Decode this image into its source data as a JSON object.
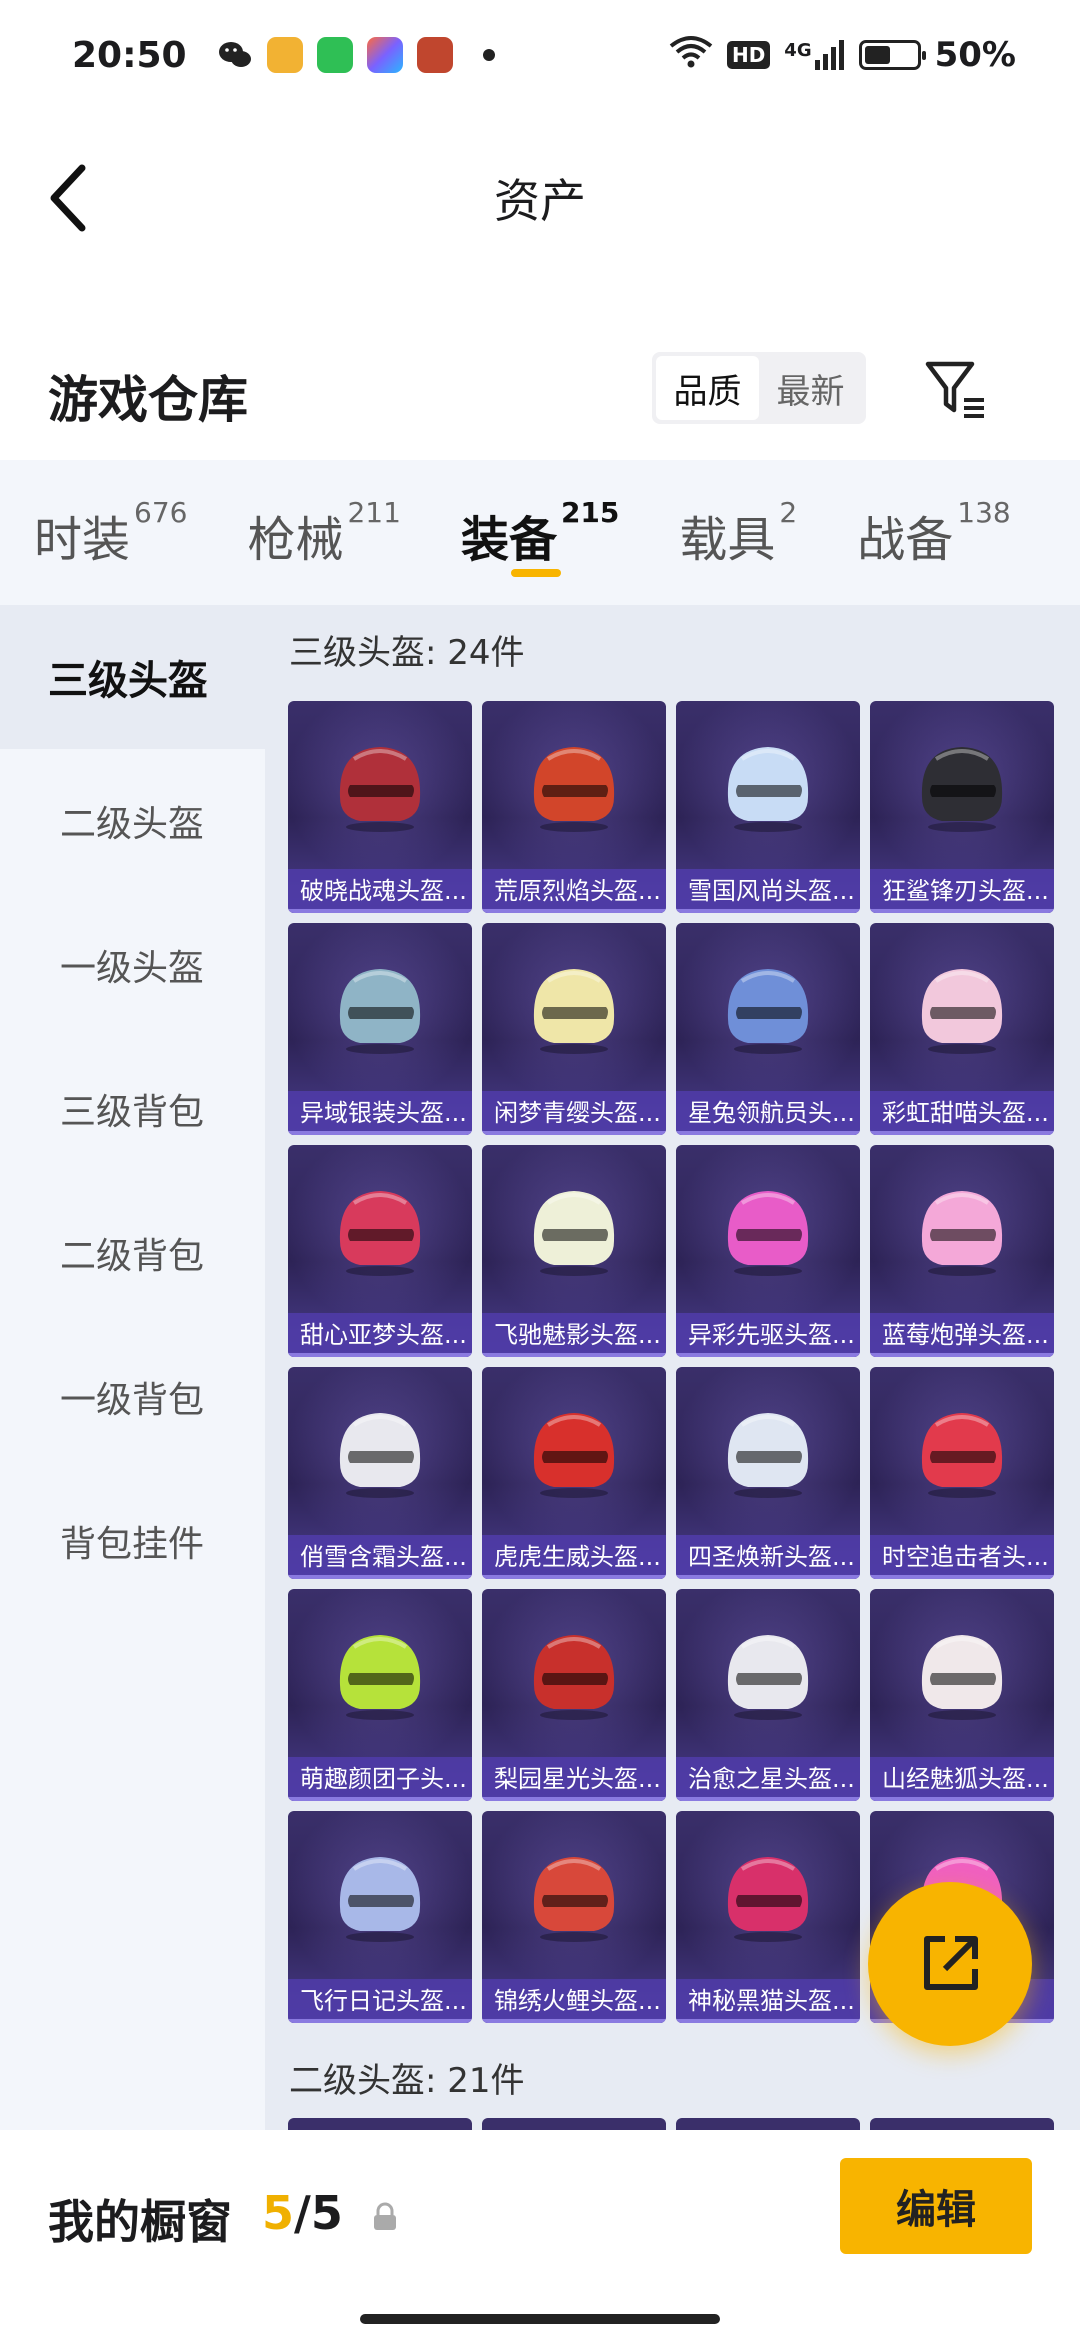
{
  "status_bar": {
    "time": "20:50",
    "network": "4G",
    "hd": "HD",
    "battery": "50%",
    "battery_level": 0.5,
    "app_icons": [
      {
        "name": "wechat-icon",
        "color": "#222222"
      },
      {
        "name": "game-app-icon",
        "color": "#f2b233"
      },
      {
        "name": "message-app-icon",
        "color": "#2fbf55"
      },
      {
        "name": "shortcut-app-icon",
        "color": "#7a62ff"
      },
      {
        "name": "hero-game-icon",
        "color": "#c0462e"
      }
    ]
  },
  "header": {
    "title": "资产"
  },
  "warehouse": {
    "title": "游戏仓库",
    "sort_options": [
      "品质",
      "最新"
    ],
    "sort_selected": "品质"
  },
  "categories": [
    {
      "label": "时装",
      "count": "676",
      "active": false
    },
    {
      "label": "枪械",
      "count": "211",
      "active": false
    },
    {
      "label": "装备",
      "count": "215",
      "active": true
    },
    {
      "label": "载具",
      "count": "2",
      "active": false
    },
    {
      "label": "战备",
      "count": "138",
      "active": false
    }
  ],
  "sidebar": {
    "items": [
      "三级头盔",
      "二级头盔",
      "一级头盔",
      "三级背包",
      "二级背包",
      "一级背包",
      "背包挂件"
    ],
    "active_index": 0
  },
  "sections": [
    {
      "title": "三级头盔: 24件"
    },
    {
      "title": "二级头盔: 21件"
    }
  ],
  "items": [
    {
      "label": "破晓战魂头盔...",
      "color": "#b0303a"
    },
    {
      "label": "荒原烈焰头盔...",
      "color": "#d2452a"
    },
    {
      "label": "雪国风尚头盔...",
      "color": "#c8dcf5"
    },
    {
      "label": "狂鲨锋刃头盔...",
      "color": "#2e2e34"
    },
    {
      "label": "异域银装头盔...",
      "color": "#8fb4c6"
    },
    {
      "label": "闲梦青缨头盔...",
      "color": "#efe6a8"
    },
    {
      "label": "星兔领航员头...",
      "color": "#6f8fd8"
    },
    {
      "label": "彩虹甜喵头盔...",
      "color": "#f2c8dc"
    },
    {
      "label": "甜心亚梦头盔...",
      "color": "#d83a5c"
    },
    {
      "label": "飞驰魅影头盔...",
      "color": "#eef0d8"
    },
    {
      "label": "异彩先驱头盔...",
      "color": "#e85cc8"
    },
    {
      "label": "蓝莓炮弹头盔...",
      "color": "#f4a8d8"
    },
    {
      "label": "俏雪含霜头盔...",
      "color": "#e8e8ee"
    },
    {
      "label": "虎虎生威头盔...",
      "color": "#d8302c"
    },
    {
      "label": "四圣焕新头盔...",
      "color": "#dfe6f2"
    },
    {
      "label": "时空追击者头...",
      "color": "#e23a4c"
    },
    {
      "label": "萌趣颜团子头...",
      "color": "#b6e23a"
    },
    {
      "label": "梨园星光头盔...",
      "color": "#c8302c"
    },
    {
      "label": "治愈之星头盔...",
      "color": "#e8e8ee"
    },
    {
      "label": "山经魅狐头盔...",
      "color": "#f0e8ea"
    },
    {
      "label": "飞行日记头盔...",
      "color": "#a8b8e8"
    },
    {
      "label": "锦绣火鲤头盔...",
      "color": "#d8483a"
    },
    {
      "label": "神秘黑猫头盔...",
      "color": "#d8306a"
    },
    {
      "label": "",
      "color": "#f060c0"
    }
  ],
  "showcase": {
    "label": "我的橱窗",
    "current": "5",
    "separator": "/",
    "total": "5",
    "edit_label": "编辑"
  },
  "colors": {
    "accent": "#f8b400",
    "card_bg": "#2d2356",
    "label_bg": "#5a44b8"
  }
}
